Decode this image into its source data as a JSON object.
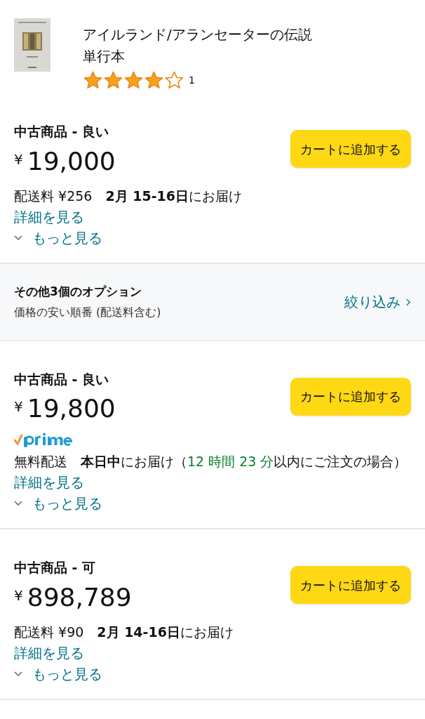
{
  "product": {
    "title": "アイルランド/アランセーターの伝説",
    "format": "単行本",
    "stars": 4,
    "review_count": "1"
  },
  "offers_top": [
    {
      "condition": "中古商品 - 良い",
      "currency": "¥",
      "amount": "19,000",
      "button": "カートに追加する",
      "prime": false,
      "delivery": [
        {
          "kind": "normal",
          "text": "配送料 ¥256　"
        },
        {
          "kind": "bold",
          "text": "2月 15-16日"
        },
        {
          "kind": "normal",
          "text": "にお届け"
        }
      ],
      "details_link": "詳細を見る",
      "more_link": "もっと見る"
    }
  ],
  "options_bar": {
    "title": "その他3個のオプション",
    "subtitle": "価格の安い順番 (配送料含む)",
    "filter_link": "絞り込み"
  },
  "offers": [
    {
      "condition": "中古商品 - 良い",
      "currency": "¥",
      "amount": "19,800",
      "button": "カートに追加する",
      "prime": true,
      "delivery": [
        {
          "kind": "normal",
          "text": "無料配送　"
        },
        {
          "kind": "bold",
          "text": "本日中"
        },
        {
          "kind": "normal",
          "text": "にお届け（"
        },
        {
          "kind": "green",
          "text": "12 時間 23 分"
        },
        {
          "kind": "normal",
          "text": "以内にご注文の場合）"
        }
      ],
      "details_link": "詳細を見る",
      "more_link": "もっと見る"
    },
    {
      "condition": "中古商品 - 可",
      "currency": "¥",
      "amount": "898,789",
      "button": "カートに追加する",
      "prime": false,
      "delivery": [
        {
          "kind": "normal",
          "text": "配送料 ¥90　"
        },
        {
          "kind": "bold",
          "text": "2月 14-16日"
        },
        {
          "kind": "normal",
          "text": "にお届け"
        }
      ],
      "details_link": "詳細を見る",
      "more_link": "もっと見る"
    }
  ]
}
